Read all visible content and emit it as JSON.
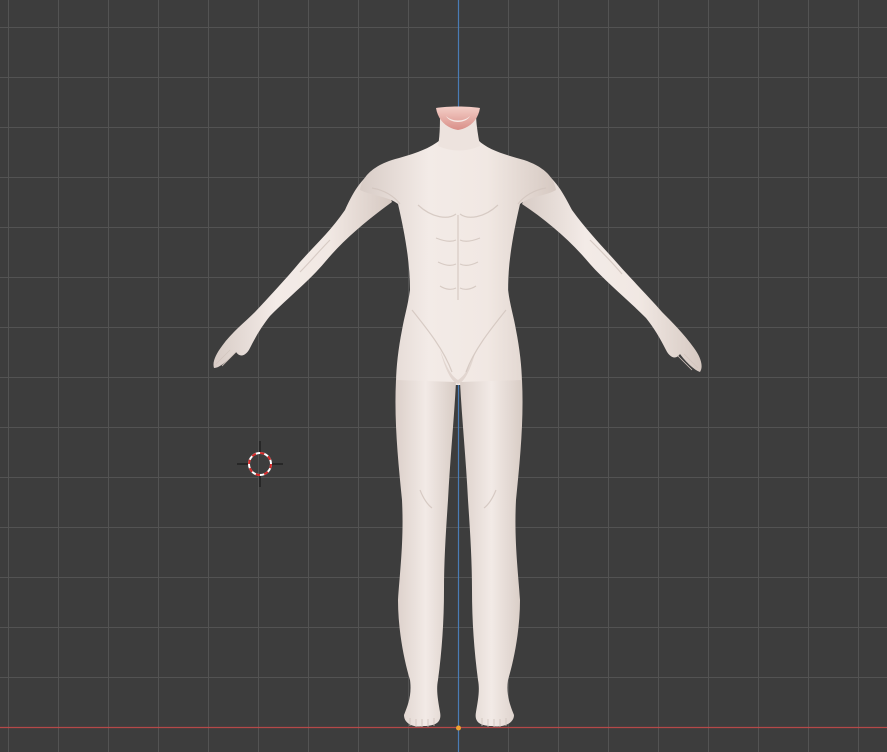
{
  "viewport": {
    "background_color": "#3d3d3d",
    "grid_line_color": "#545454",
    "x_axis_color": "#b54a4a",
    "z_axis_color": "#4a7fb8",
    "origin_dot_color": "#f0a030",
    "mesh_color": "#efe6e1",
    "mesh_shadow_color": "#d9ccc6",
    "neck_cut_color": "#e8b8b4"
  },
  "icons": {
    "cursor": "3d-cursor-icon",
    "origin": "object-origin-icon"
  }
}
